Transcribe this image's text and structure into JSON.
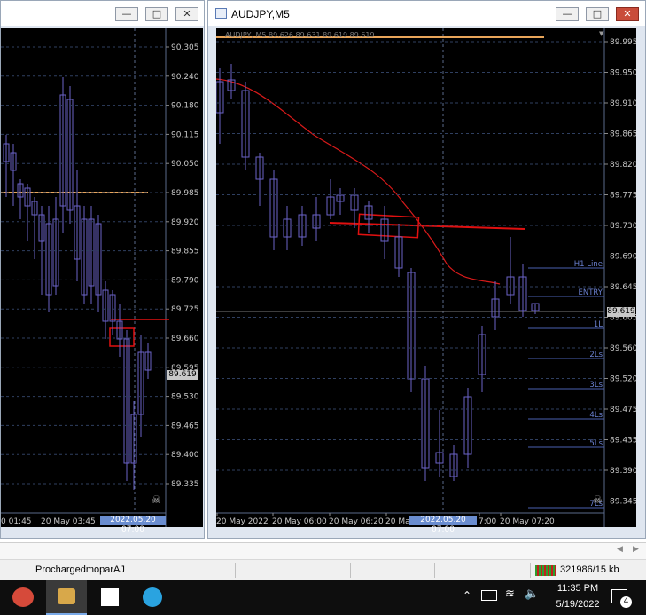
{
  "left_window": {
    "price_labels": [
      "90.305",
      "90.240",
      "90.180",
      "90.115",
      "90.050",
      "89.985",
      "89.920",
      "89.855",
      "89.790",
      "89.725",
      "89.660",
      "89.595",
      "89.530",
      "89.465",
      "89.400",
      "89.335"
    ],
    "current_price": "89.619",
    "time_labels": [
      "0 01:45",
      "20 May 03:45"
    ],
    "cursor_time": "2022.05.20 07:00"
  },
  "right_window": {
    "title": "AUDJPY,M5",
    "info_line": "AUDJPY, M5  89.626 89.631 89.619 89.619",
    "price_labels": [
      "89.995",
      "89.950",
      "89.910",
      "89.865",
      "89.820",
      "89.775",
      "89.730",
      "89.690",
      "89.645",
      "89.605",
      "89.560",
      "89.520",
      "89.475",
      "89.435",
      "89.390",
      "89.345"
    ],
    "current_price": "89.619",
    "line_labels": [
      "H1 Line",
      "ENTRY",
      "1L",
      "2Ls",
      "3Ls",
      "4Ls",
      "5Ls",
      "7Ls"
    ],
    "time_labels": [
      "20 May 2022",
      "20 May 06:00",
      "20 May 06:20",
      "20 Ma",
      "7:00",
      "20 May 07:20"
    ],
    "cursor_time": "2022.05.20 07:00"
  },
  "status": {
    "profile": "ProchargedmoparAJ",
    "traffic": "321986/15 kb"
  },
  "taskbar": {
    "time": "11:35 PM",
    "date": "5/19/2022",
    "notifications": "4"
  },
  "colors": {
    "chart_bg": "#000000",
    "candle": "#6b63c9",
    "grid": "#3a4a6a",
    "orange_line": "#e8a55a",
    "ma_line": "#d81a1a",
    "annotation": "#e01010",
    "level_line": "#4a5fb0"
  }
}
